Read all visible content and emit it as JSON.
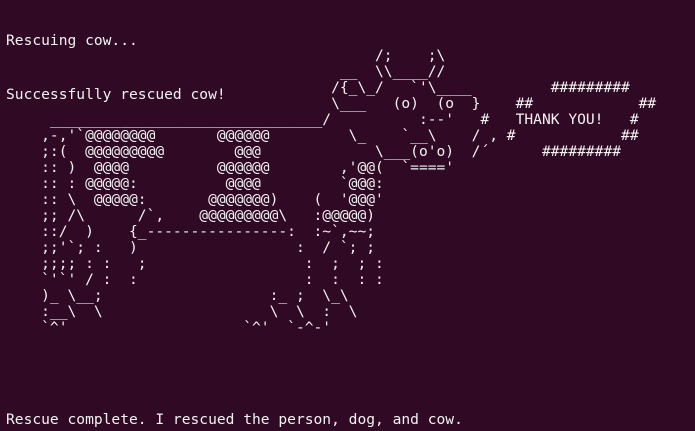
{
  "terminal": {
    "background": "#300a24",
    "foreground": "#f2f2f2",
    "status_lines": [
      "Rescuing cow...",
      "Successfully rescued cow!"
    ],
    "ascii_art": "                                          /;    ;\\\n                                      __  \\\\____//\n                                     /{_\\_/   `'\\____         #########\n                                     \\___   (o)  (o  }    ##            ##\n     _______________________________/          :--'   #   THANK YOU!   #\n    ,-,'`@@@@@@@@       @@@@@@         \\_    `__\\    / , #            ##\n    ;:(  @@@@@@@@@        @@@             \\___(o'o)  /´      #########\n    :: )  @@@@          @@@@@@        ,'@@(  `====' \n    :: : @@@@@:          @@@@         `@@@:\n    :: \\  @@@@@:       @@@@@@@)    (  '@@@'\n    ;; /\\      /`,    @@@@@@@@@\\   :@@@@@)\n    ::/  )    {_----------------:  :~`,~~;\n    ;;'`; :   )                  :  / `; ;\n    ;;;; : :   ;                  :  ;  ; :\n    `'`' / :  :                   :  :  : :\n    )_ \\__;                   :_ ;  \\_\\\n    :__\\  \\                   \\  \\  :  \\\n    `^'                    `^'  `-^-'",
    "final_line": "Rescue complete. I rescued the person, dog, and cow."
  }
}
